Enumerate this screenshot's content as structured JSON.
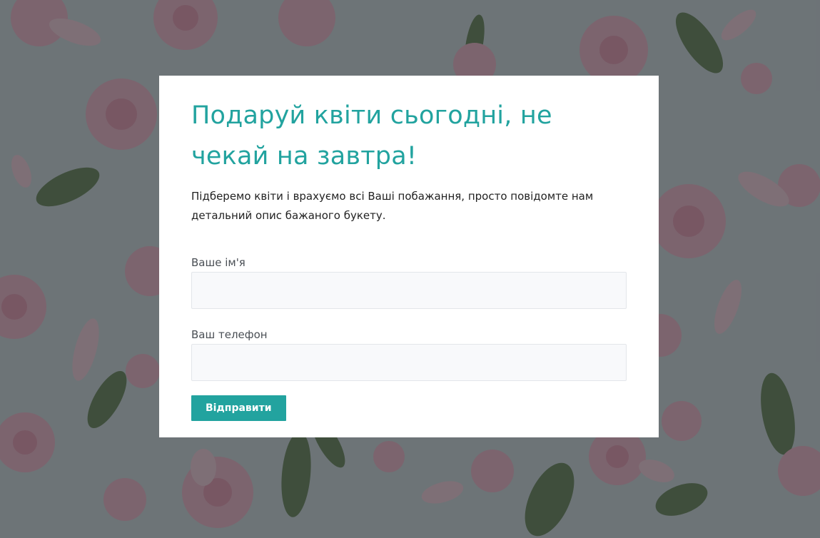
{
  "form": {
    "title": "Подаруй квіти сьогодні, не чекай на завтра!",
    "description": "Підберемо квіти і врахуємо всі Ваші побажання, просто повідомте нам детальний опис бажаного букету.",
    "name_label": "Ваше ім'я",
    "name_value": "",
    "phone_label": "Ваш телефон",
    "phone_value": "",
    "submit_label": "Відправити"
  },
  "colors": {
    "accent": "#22a39f",
    "background": "#c9d0d4",
    "rose": "#f3bccb",
    "leaf": "#5f7a4a"
  },
  "background": {
    "image": "roses-and-petals-pattern"
  }
}
